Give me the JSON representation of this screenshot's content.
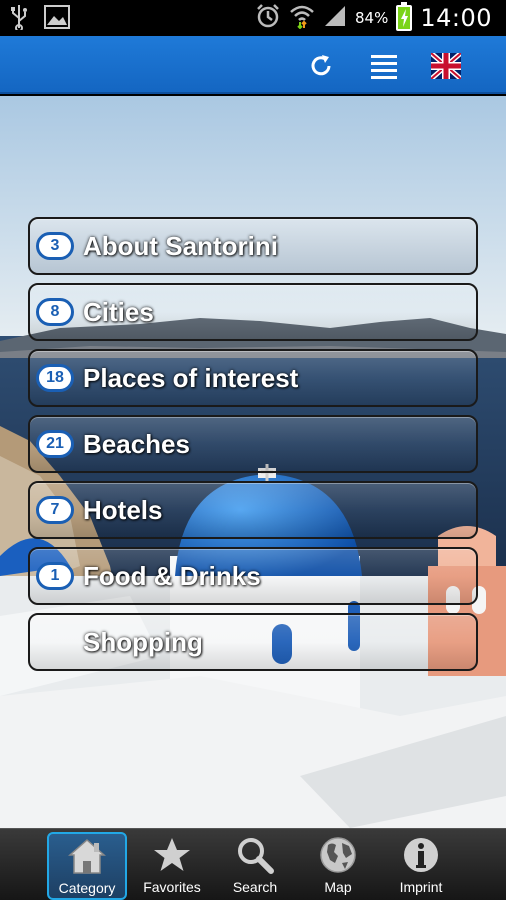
{
  "status_bar": {
    "battery_percent": "84%",
    "time": "14:00",
    "icons": [
      "usb-icon",
      "image-icon",
      "alarm-icon",
      "wifi-icon",
      "signal-icon",
      "battery-icon"
    ]
  },
  "action_bar": {
    "buttons": [
      "refresh-icon",
      "list-icon",
      "uk-flag-icon"
    ]
  },
  "menu": {
    "items": [
      {
        "count": "3",
        "label": "About Santorini"
      },
      {
        "count": "8",
        "label": "Cities"
      },
      {
        "count": "18",
        "label": "Places of interest"
      },
      {
        "count": "21",
        "label": "Beaches"
      },
      {
        "count": "7",
        "label": "Hotels"
      },
      {
        "count": "1",
        "label": "Food & Drinks"
      },
      {
        "count": "",
        "label": "Shopping"
      }
    ]
  },
  "tab_bar": {
    "tabs": [
      {
        "label": "Category",
        "icon": "home-icon",
        "active": true
      },
      {
        "label": "Favorites",
        "icon": "star-icon",
        "active": false
      },
      {
        "label": "Search",
        "icon": "magnifier-icon",
        "active": false
      },
      {
        "label": "Map",
        "icon": "globe-icon",
        "active": false
      },
      {
        "label": "Imprint",
        "icon": "info-icon",
        "active": false
      }
    ]
  },
  "colors": {
    "action_bar": "#1a6fcc",
    "badge_border": "#1a5fb4",
    "active_tab_border": "#22a8e6"
  }
}
